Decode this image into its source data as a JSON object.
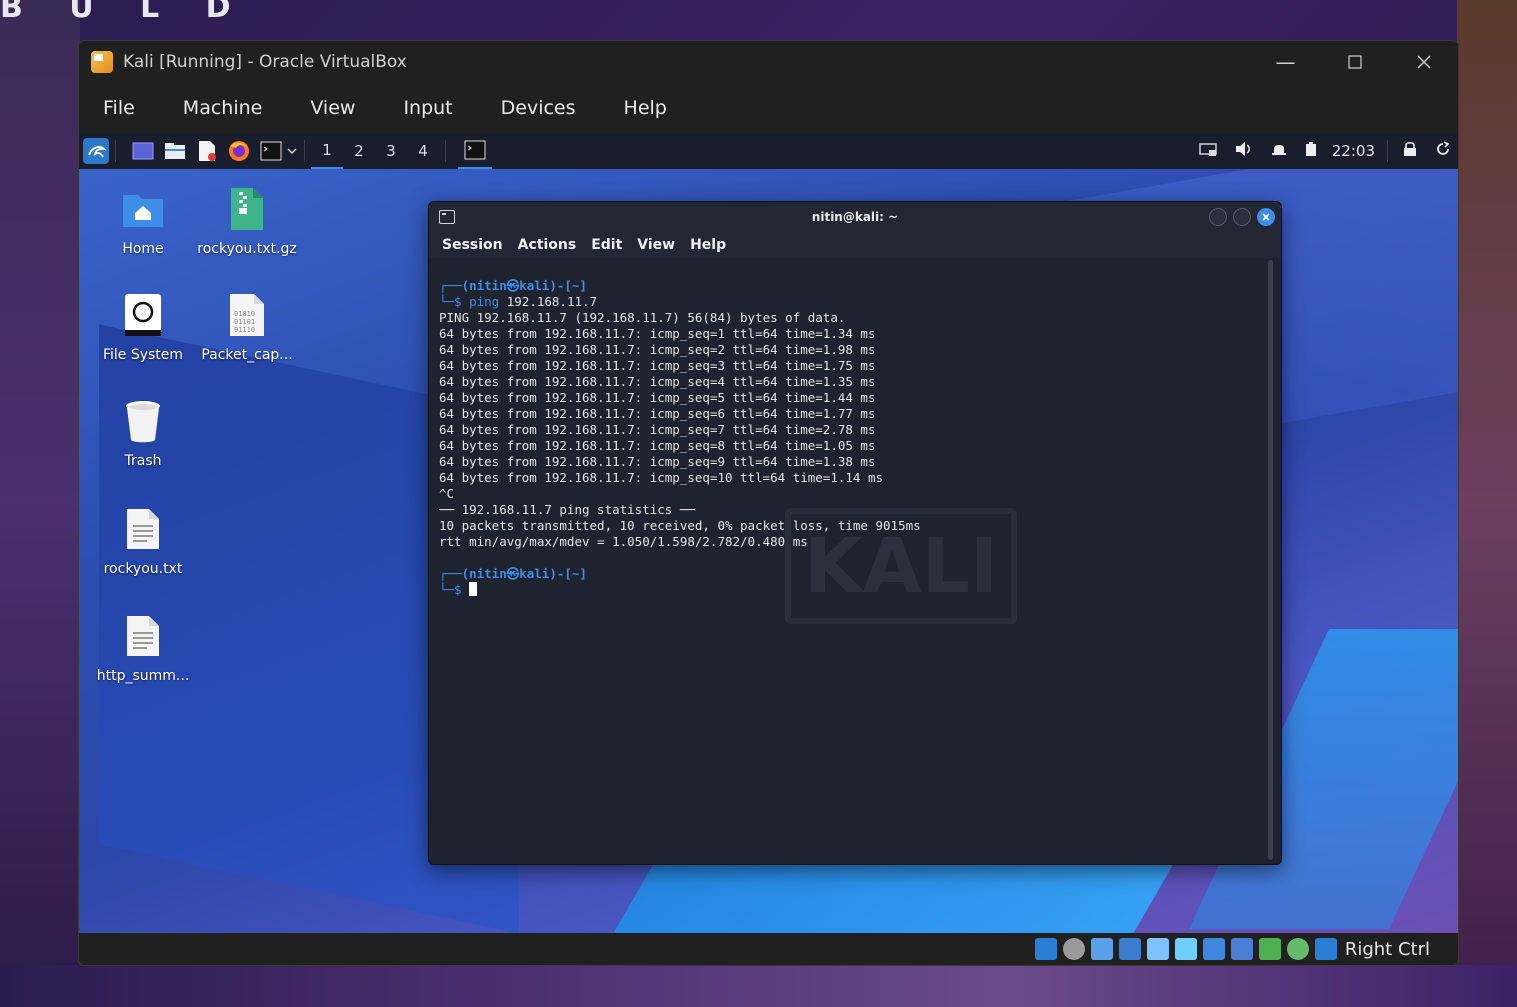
{
  "host": {
    "top_text": "B U L D"
  },
  "vbox": {
    "title": "Kali [Running] - Oracle VirtualBox",
    "menu": [
      "File",
      "Machine",
      "View",
      "Input",
      "Devices",
      "Help"
    ],
    "host_key": "Right Ctrl"
  },
  "panel": {
    "workspaces": [
      "1",
      "2",
      "3",
      "4"
    ],
    "active_workspace": "1",
    "clock": "22:03"
  },
  "desktop": {
    "icons": [
      {
        "label": "Home",
        "icon": "home-folder-icon"
      },
      {
        "label": "rockyou.txt.gz",
        "icon": "archive-icon"
      },
      {
        "label": "File System",
        "icon": "drive-icon"
      },
      {
        "label": "Packet_cap...",
        "icon": "binary-file-icon"
      },
      {
        "label": "Trash",
        "icon": "trash-icon"
      },
      {
        "label": "rockyou.txt",
        "icon": "text-file-icon"
      },
      {
        "label": "http_summ...",
        "icon": "text-file-icon"
      }
    ]
  },
  "terminal": {
    "title": "nitin@kali: ~",
    "menu": [
      "Session",
      "Actions",
      "Edit",
      "View",
      "Help"
    ],
    "prompt_user": "(nitin㉿kali)-[~]",
    "command": "ping",
    "command_arg": "192.168.11.7",
    "output": [
      "PING 192.168.11.7 (192.168.11.7) 56(84) bytes of data.",
      "64 bytes from 192.168.11.7: icmp_seq=1 ttl=64 time=1.34 ms",
      "64 bytes from 192.168.11.7: icmp_seq=2 ttl=64 time=1.98 ms",
      "64 bytes from 192.168.11.7: icmp_seq=3 ttl=64 time=1.75 ms",
      "64 bytes from 192.168.11.7: icmp_seq=4 ttl=64 time=1.35 ms",
      "64 bytes from 192.168.11.7: icmp_seq=5 ttl=64 time=1.44 ms",
      "64 bytes from 192.168.11.7: icmp_seq=6 ttl=64 time=1.77 ms",
      "64 bytes from 192.168.11.7: icmp_seq=7 ttl=64 time=2.78 ms",
      "64 bytes from 192.168.11.7: icmp_seq=8 ttl=64 time=1.05 ms",
      "64 bytes from 192.168.11.7: icmp_seq=9 ttl=64 time=1.38 ms",
      "64 bytes from 192.168.11.7: icmp_seq=10 ttl=64 time=1.14 ms",
      "^C",
      "── 192.168.11.7 ping statistics ──",
      "10 packets transmitted, 10 received, 0% packet loss, time 9015ms",
      "rtt min/avg/max/mdev = 1.050/1.598/2.782/0.480 ms"
    ],
    "watermark": "KALI"
  }
}
